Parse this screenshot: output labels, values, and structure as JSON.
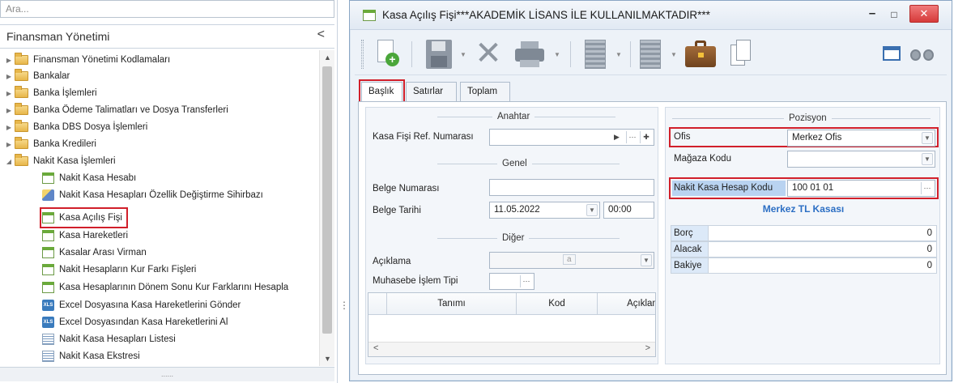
{
  "left_panel": {
    "search_placeholder": "Ara...",
    "title": "Finansman Yönetimi",
    "collapse_glyph": "<",
    "footer_dots": "......",
    "tree": [
      {
        "label": "Finansman Yönetimi Kodlamaları",
        "type": "folder",
        "expanded": false
      },
      {
        "label": "Bankalar",
        "type": "folder",
        "expanded": false
      },
      {
        "label": "Banka İşlemleri",
        "type": "folder",
        "expanded": false
      },
      {
        "label": "Banka Ödeme Talimatları ve Dosya Transferleri",
        "type": "folder",
        "expanded": false
      },
      {
        "label": "Banka DBS Dosya İşlemleri",
        "type": "folder",
        "expanded": false
      },
      {
        "label": "Banka Kredileri",
        "type": "folder",
        "expanded": false
      },
      {
        "label": "Nakit Kasa İşlemleri",
        "type": "folder",
        "expanded": true
      },
      {
        "label": "Nakit Kasa Hesabı",
        "type": "item",
        "icon": "cash-register-icon"
      },
      {
        "label": "Nakit Kasa Hesapları Özellik Değiştirme Sihirbazı",
        "type": "item",
        "icon": "wizard-icon"
      },
      {
        "label": "Kasa Açılış Fişi",
        "type": "item",
        "icon": "form-icon",
        "highlighted": true
      },
      {
        "label": "Kasa Hareketleri",
        "type": "item",
        "icon": "form-icon"
      },
      {
        "label": "Kasalar Arası Virman",
        "type": "item",
        "icon": "form-icon"
      },
      {
        "label": "Nakit Hesapların Kur Farkı Fişleri",
        "type": "item",
        "icon": "form-icon"
      },
      {
        "label": "Kasa Hesaplarının Dönem Sonu Kur Farklarını Hesapla",
        "type": "item",
        "icon": "form-icon"
      },
      {
        "label": "Excel Dosyasına Kasa Hareketlerini Gönder",
        "type": "item",
        "icon": "excel-icon"
      },
      {
        "label": "Excel Dosyasından Kasa Hareketlerini Al",
        "type": "item",
        "icon": "excel-icon"
      },
      {
        "label": "Nakit Kasa Hesapları Listesi",
        "type": "item",
        "icon": "list-icon"
      },
      {
        "label": "Nakit Kasa Ekstresi",
        "type": "item",
        "icon": "list-icon"
      }
    ]
  },
  "window": {
    "title": "Kasa Açılış Fişi***AKADEMİK LİSANS İLE KULLANILMAKTADIR***",
    "min_glyph": "–",
    "max_glyph": "□",
    "close_glyph": "✕",
    "tabs": [
      {
        "label": "Başlık",
        "active": true,
        "highlighted": true
      },
      {
        "label": "Satırlar",
        "active": false
      },
      {
        "label": "Toplam",
        "active": false
      }
    ]
  },
  "form": {
    "anahtar": {
      "title": "Anahtar",
      "ref_label": "Kasa Fişi Ref. Numarası",
      "ref_value": ""
    },
    "genel": {
      "title": "Genel",
      "belge_no_label": "Belge Numarası",
      "belge_no_value": "",
      "belge_tarihi_label": "Belge Tarihi",
      "date_value": "11.05.2022",
      "time_value": "00:00"
    },
    "diger": {
      "title": "Diğer",
      "aciklama_label": "Açıklama",
      "aciklama_glyph": "a",
      "muhasebe_label": "Muhasebe İşlem Tipi",
      "muhasebe_value": ""
    },
    "grid": {
      "columns": [
        "Tanımı",
        "Kod",
        "Açıklam"
      ],
      "scroll_left": "<",
      "scroll_right": ">"
    }
  },
  "pozisyon": {
    "title": "Pozisyon",
    "ofis_label": "Ofis",
    "ofis_value": "Merkez Ofis",
    "magaza_label": "Mağaza Kodu",
    "magaza_value": "",
    "hesap_kodu_label": "Nakit Kasa Hesap Kodu",
    "hesap_kodu_value": "100 01 01",
    "hesap_name": "Merkez TL Kasası",
    "balances": [
      {
        "label": "Borç",
        "value": "0"
      },
      {
        "label": "Alacak",
        "value": "0"
      },
      {
        "label": "Bakiye",
        "value": "0"
      }
    ]
  },
  "colors": {
    "highlight_red": "#d11f2a",
    "accent_blue": "#2c6fc4",
    "selection_blue": "#b9d3f1"
  }
}
